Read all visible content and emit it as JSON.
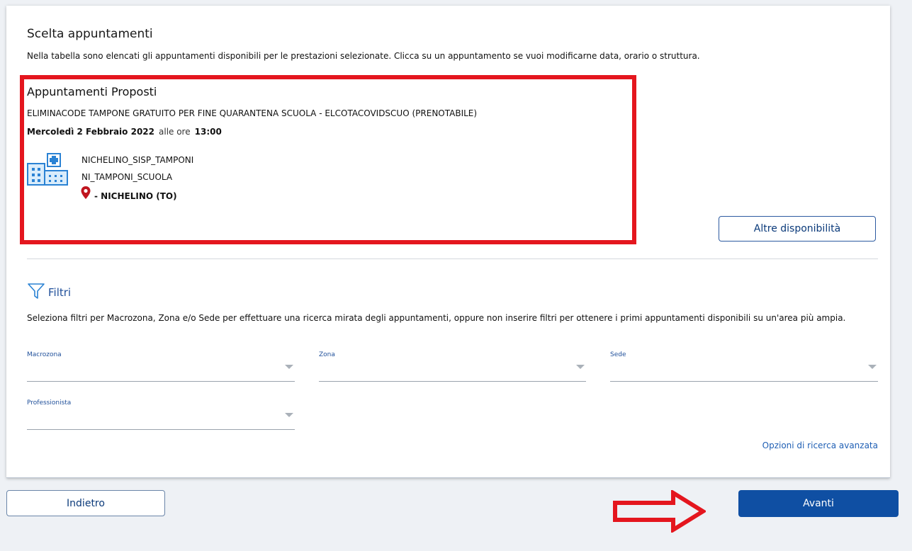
{
  "page": {
    "title": "Scelta appuntamenti",
    "subtitle": "Nella tabella sono elencati gli appuntamenti disponibili per le prestazioni selezionate. Clicca su un appuntamento se vuoi modificarne data, orario o struttura."
  },
  "appointment": {
    "section_title": "Appuntamenti Proposti",
    "service": "ELIMINACODE TAMPONE GRATUITO PER FINE QUARANTENA SCUOLA - ELCOTACOVIDSCUO (PRENOTABILE)",
    "date": "Mercoledì 2 Febbraio 2022",
    "time_prefix": "alle ore",
    "time": "13:00",
    "structure_name": "NICHELINO_SISP_TAMPONI",
    "structure_unit": "NI_TAMPONI_SCUOLA",
    "city": "- NICHELINO (TO)",
    "icon": "hospital-building-icon",
    "pin_icon": "location-pin-icon",
    "highlight_color": "#e4161e"
  },
  "buttons": {
    "altre": "Altre disponibilità",
    "indietro": "Indietro",
    "avanti": "Avanti"
  },
  "filters": {
    "title": "Filtri",
    "icon": "funnel-icon",
    "description": "Seleziona filtri per Macrozona, Zona e/o Sede per effettuare una ricerca mirata degli appuntamenti, oppure non inserire filtri per ottenere i primi appuntamenti disponibili su un'area più ampia.",
    "fields": {
      "macrozona": "Macrozona",
      "zona": "Zona",
      "sede": "Sede",
      "professionista": "Professionista"
    },
    "advanced_link": "Opzioni di ricerca avanzata"
  },
  "annotation": {
    "arrow_color": "#e4161e"
  },
  "colors": {
    "primary": "#0f4fa3",
    "link": "#1f5fb4"
  }
}
